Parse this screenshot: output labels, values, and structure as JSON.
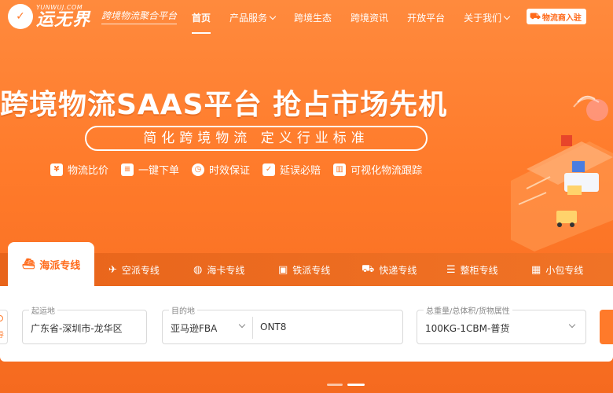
{
  "brand": {
    "logo_en": "YUNWUJ.COM",
    "logo_cn": "运无界",
    "slogan": "跨境物流聚合平台"
  },
  "nav": {
    "items": [
      {
        "label": "首页",
        "active": true,
        "dropdown": false
      },
      {
        "label": "产品服务",
        "active": false,
        "dropdown": true
      },
      {
        "label": "跨境生态",
        "active": false,
        "dropdown": false
      },
      {
        "label": "跨境资讯",
        "active": false,
        "dropdown": false
      },
      {
        "label": "开放平台",
        "active": false,
        "dropdown": false
      },
      {
        "label": "关于我们",
        "active": false,
        "dropdown": true
      }
    ],
    "merchant_button": "物流商入驻"
  },
  "hero": {
    "title": "跨境物流SAAS平台  抢占市场先机",
    "subtitle": "简化跨境物流  定义行业标准",
    "features": [
      {
        "icon": "yen-icon",
        "label": "物流比价"
      },
      {
        "icon": "order-icon",
        "label": "一键下单"
      },
      {
        "icon": "clock-icon",
        "label": "时效保证"
      },
      {
        "icon": "shield-icon",
        "label": "延误必赔"
      },
      {
        "icon": "chart-icon",
        "label": "可视化物流跟踪"
      }
    ]
  },
  "tabs": [
    {
      "icon": "ship-icon",
      "label": "海派专线",
      "active": true
    },
    {
      "icon": "plane-icon",
      "label": "空派专线",
      "active": false
    },
    {
      "icon": "globe-icon",
      "label": "海卡专线",
      "active": false
    },
    {
      "icon": "train-icon",
      "label": "铁派专线",
      "active": false
    },
    {
      "icon": "truck-icon",
      "label": "快递专线",
      "active": false
    },
    {
      "icon": "container-icon",
      "label": "整柜专线",
      "active": false
    },
    {
      "icon": "package-icon",
      "label": "小包专线",
      "active": false
    }
  ],
  "search": {
    "origin": {
      "label": "起运地",
      "value": "广东省-深圳市-龙华区"
    },
    "destination": {
      "label": "目的地",
      "type_value": "亚马逊FBA",
      "code_value": "ONT8"
    },
    "cargo": {
      "label": "总重量/总体积/货物属性",
      "value": "100KG-1CBM-普货"
    },
    "left_partial_char": "导"
  },
  "colors": {
    "accent": "#ff7a2a",
    "accent_dark": "#e8641a"
  }
}
